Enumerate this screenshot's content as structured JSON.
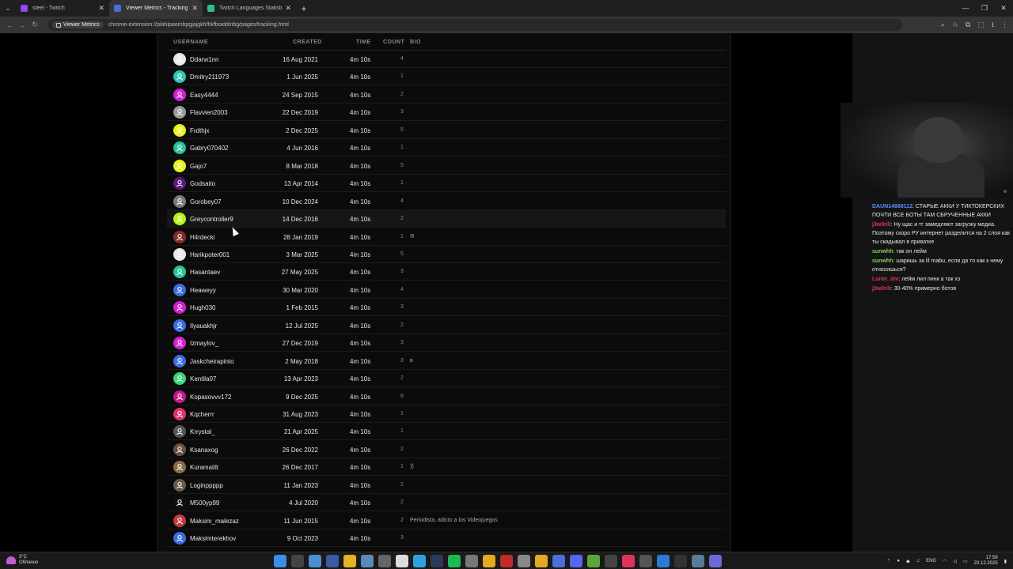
{
  "browser": {
    "tabs": [
      {
        "title": "steel - Twitch",
        "color": "#9146ff",
        "active": false
      },
      {
        "title": "Viewer Metrics - Tracking",
        "color": "#4a6fd6",
        "active": true
      },
      {
        "title": "Twitch Languages Statistics - Tw",
        "color": "#2fbf8f",
        "active": false
      }
    ],
    "chip_label": "Viewer Metrics",
    "url": "chrome-extension://plahipaombpgjajgkhfhkfboiddinbg/pages/tracking.html"
  },
  "table": {
    "headers": {
      "username": "USERNAME",
      "created": "CREATED",
      "time": "TIME",
      "count": "COUNT",
      "bio": "BIO"
    },
    "rows": [
      {
        "username": "Ddarw1nn",
        "created": "16 Aug 2021",
        "time": "4m 10s",
        "count": "4",
        "bio": "",
        "avatar_color": "#e8e8e8"
      },
      {
        "username": "Dmitry211973",
        "created": "1 Jun 2025",
        "time": "4m 10s",
        "count": "1",
        "bio": "",
        "avatar_color": "#2ec4b6"
      },
      {
        "username": "Easy4444",
        "created": "24 Sep 2015",
        "time": "4m 10s",
        "count": "2",
        "bio": "",
        "avatar_color": "#d61fd6"
      },
      {
        "username": "Flavvien2003",
        "created": "22 Dec 2019",
        "time": "4m 10s",
        "count": "3",
        "bio": "",
        "avatar_color": "#9a9a9a"
      },
      {
        "username": "Frdthjx",
        "created": "2 Dec 2025",
        "time": "4m 10s",
        "count": "5",
        "bio": "",
        "avatar_color": "#e6f21a"
      },
      {
        "username": "Gabry070402",
        "created": "4 Jun 2016",
        "time": "4m 10s",
        "count": "1",
        "bio": "",
        "avatar_color": "#26c49a"
      },
      {
        "username": "Gajo7",
        "created": "8 Mar 2018",
        "time": "4m 10s",
        "count": "5",
        "bio": "",
        "avatar_color": "#e6f21a"
      },
      {
        "username": "Godsaito",
        "created": "13 Apr 2014",
        "time": "4m 10s",
        "count": "1",
        "bio": "",
        "avatar_color": "#5a1a7a"
      },
      {
        "username": "Gorobey07",
        "created": "10 Dec 2024",
        "time": "4m 10s",
        "count": "4",
        "bio": "",
        "avatar_color": "#7a7a7a"
      },
      {
        "username": "Greycontroller9",
        "created": "14 Dec 2016",
        "time": "4m 10s",
        "count": "2",
        "bio": "",
        "avatar_color": "#b6f21a"
      },
      {
        "username": "H4rdecki",
        "created": "28 Jan 2019",
        "time": "4m 10s",
        "count": "1",
        "bio": "Я",
        "avatar_color": "#8a2a2a"
      },
      {
        "username": "Harikpoter001",
        "created": "3 Mar 2025",
        "time": "4m 10s",
        "count": "5",
        "bio": "",
        "avatar_color": "#e8e8e8"
      },
      {
        "username": "Hasantaev",
        "created": "27 May 2025",
        "time": "4m 10s",
        "count": "3",
        "bio": "",
        "avatar_color": "#26c49a"
      },
      {
        "username": "Heaweyy",
        "created": "30 Mar 2020",
        "time": "4m 10s",
        "count": "4",
        "bio": "",
        "avatar_color": "#3a6fe0"
      },
      {
        "username": "Hugh030",
        "created": "1 Feb 2015",
        "time": "4m 10s",
        "count": "3",
        "bio": "",
        "avatar_color": "#d61fd6"
      },
      {
        "username": "Ilyauakhjr",
        "created": "12 Jul 2025",
        "time": "4m 10s",
        "count": "2",
        "bio": "",
        "avatar_color": "#3a6fe0"
      },
      {
        "username": "Izmaylov_",
        "created": "27 Dec 2019",
        "time": "4m 10s",
        "count": "3",
        "bio": "",
        "avatar_color": "#d61fd6"
      },
      {
        "username": "Jaskcheirapinto",
        "created": "2 May 2018",
        "time": "4m 10s",
        "count": "3",
        "bio": "в",
        "avatar_color": "#3a6fe0"
      },
      {
        "username": "Kentila07",
        "created": "13 Apr 2023",
        "time": "4m 10s",
        "count": "2",
        "bio": "",
        "avatar_color": "#3ad67a"
      },
      {
        "username": "Kopasovvv172",
        "created": "9 Dec 2025",
        "time": "4m 10s",
        "count": "6",
        "bio": "",
        "avatar_color": "#c21a8a"
      },
      {
        "username": "Kqcherrr",
        "created": "31 Aug 2023",
        "time": "4m 10s",
        "count": "1",
        "bio": "",
        "avatar_color": "#e0336a"
      },
      {
        "username": "Krrystal_",
        "created": "21 Apr 2025",
        "time": "4m 10s",
        "count": "1",
        "bio": "",
        "avatar_color": "#555555"
      },
      {
        "username": "Ksanaxog",
        "created": "26 Dec 2022",
        "time": "4m 10s",
        "count": "2",
        "bio": "",
        "avatar_color": "#6a5040"
      },
      {
        "username": "Kuramatilt",
        "created": "26 Dec 2017",
        "time": "4m 10s",
        "count": "1",
        "bio": "))",
        "avatar_color": "#8a6a4a"
      },
      {
        "username": "Loginppppp",
        "created": "11 Jan 2023",
        "time": "4m 10s",
        "count": "2",
        "bio": "",
        "avatar_color": "#6a5a4a"
      },
      {
        "username": "M500yp99",
        "created": "4 Jul 2020",
        "time": "4m 10s",
        "count": "2",
        "bio": "",
        "avatar_color": "#111111"
      },
      {
        "username": "Maksim_malezaz",
        "created": "11 Jun 2015",
        "time": "4m 10s",
        "count": "2",
        "bio": "Periodista, adicto a los Videojuegos",
        "avatar_color": "#c23a3a"
      },
      {
        "username": "Maksimterekhov",
        "created": "9 Oct 2023",
        "time": "4m 10s",
        "count": "3",
        "bio": "",
        "avatar_color": "#3a6fe0"
      }
    ]
  },
  "chat": [
    {
      "nick": "DAUN14888112",
      "sep": ": ",
      "text": "СТАРЫЕ АККИ У ТИКТОКЕРСКИХ ПОЧТИ ВСЕ БОТЫ ТАМ СБРУЧЕННЫЕ АККИ",
      "color": "#5b8cff"
    },
    {
      "nick": "j3w3rili",
      "sep": ": ",
      "text": "Ну щас и тг замедляют загрузку медиа. Поэтому скоро РУ интернет разделится на 2 слоя как ты скидывал в приватке",
      "color": "#e0335a"
    },
    {
      "nick": "sunwhh",
      "sep": ": ",
      "text": "так он лейм",
      "color": "#7cd65a"
    },
    {
      "nick": "sunwhh",
      "sep": ": ",
      "text": "шаришь за lil mabu, если да то как к нему относишься?",
      "color": "#7cd65a"
    },
    {
      "nick": "Lunin_dm",
      "sep": ": ",
      "text": "лейм лил пинк а так хз",
      "color": "#e0335a"
    },
    {
      "nick": "j3w3rili",
      "sep": ": ",
      "text": "30-40% примерно ботов",
      "color": "#e0335a"
    }
  ],
  "taskbar": {
    "weather_temp": "3°C",
    "weather_text": "Облачно",
    "lang": "ENG",
    "time": "17:58",
    "date": "23.12.2025"
  }
}
